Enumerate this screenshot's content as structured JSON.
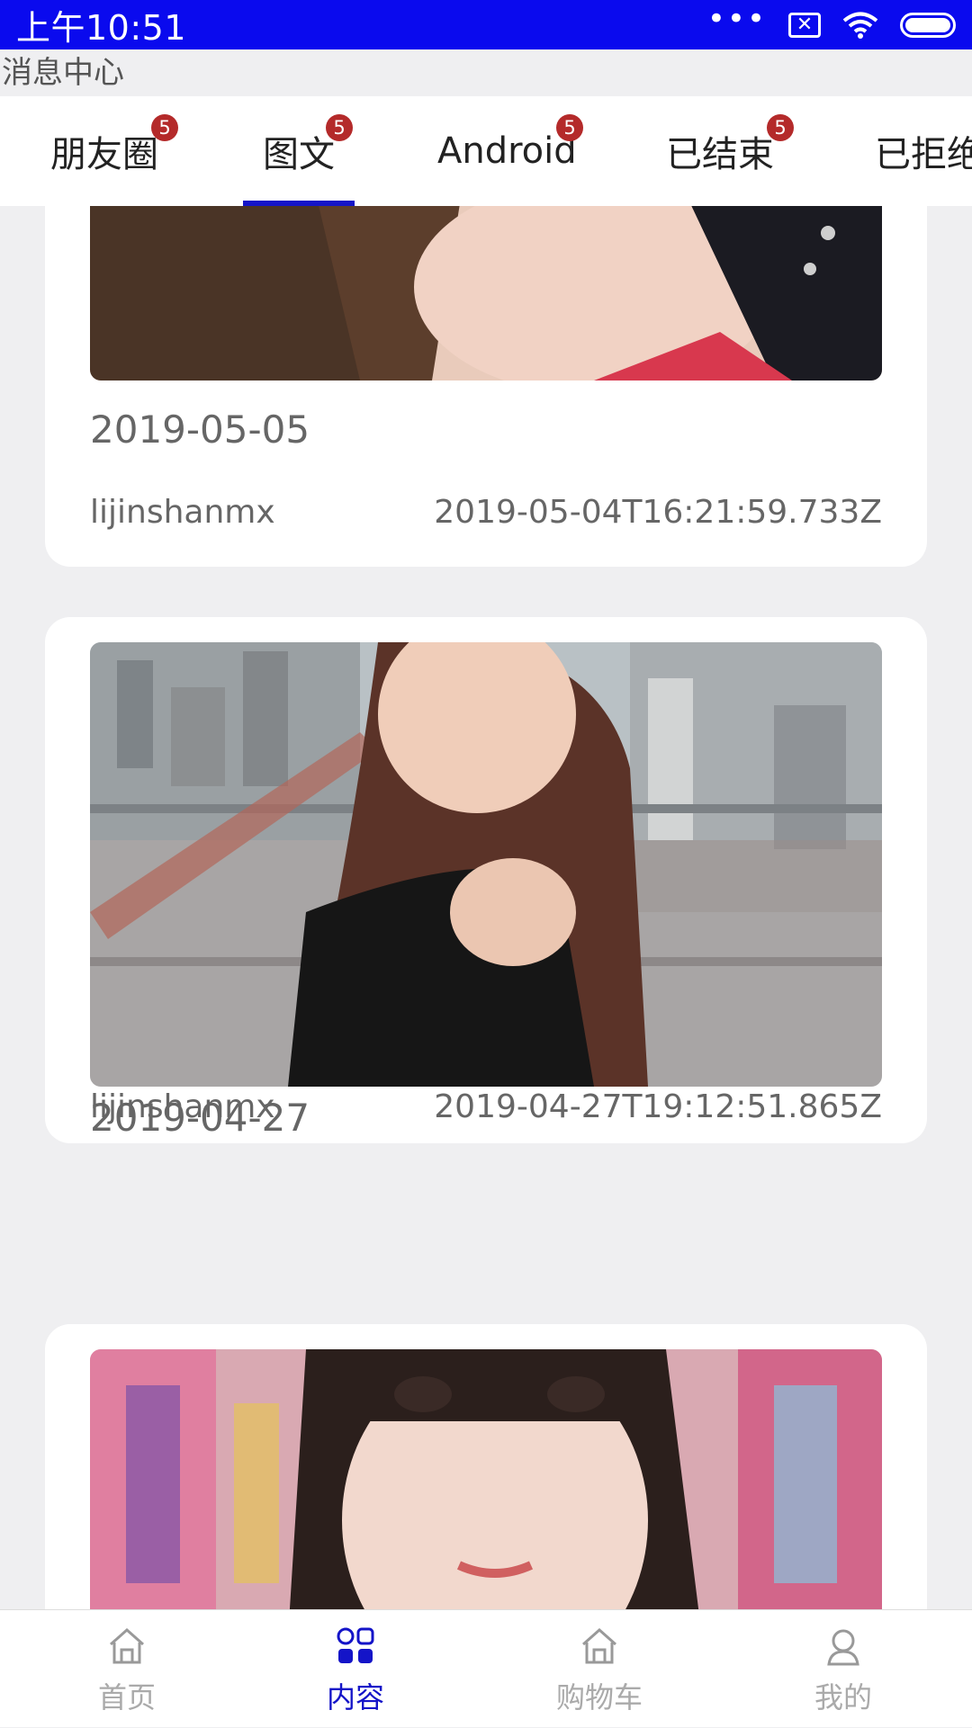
{
  "status_bar": {
    "time": "上午10:51",
    "dots": "•••",
    "icons": [
      "sim-x-icon",
      "wifi-icon",
      "battery-icon"
    ]
  },
  "header": {
    "title": "消息中心"
  },
  "tabs": [
    {
      "label": "朋友圈",
      "badge": "5"
    },
    {
      "label": "图文",
      "badge": "5",
      "active": true
    },
    {
      "label": "Android",
      "badge": "5"
    },
    {
      "label": "已结束",
      "badge": "5"
    },
    {
      "label": "已拒绝"
    }
  ],
  "posts": [
    {
      "date": "2019-05-05",
      "author": "lijinshanmx",
      "timestamp": "2019-05-04T16:21:59.733Z"
    },
    {
      "date": "2019-04-27",
      "author": "lijinshanmx",
      "timestamp": "2019-04-27T19:12:51.865Z"
    },
    {
      "date": "",
      "author": "",
      "timestamp": ""
    }
  ],
  "bottom_nav": [
    {
      "label": "首页",
      "icon": "home-icon"
    },
    {
      "label": "内容",
      "icon": "grid-icon",
      "active": true
    },
    {
      "label": "购物车",
      "icon": "cart-icon"
    },
    {
      "label": "我的",
      "icon": "profile-icon"
    }
  ],
  "colors": {
    "status_bar": "#0a0aee",
    "accent": "#1414c8",
    "badge": "#b42a2a",
    "background": "#efeff1"
  }
}
